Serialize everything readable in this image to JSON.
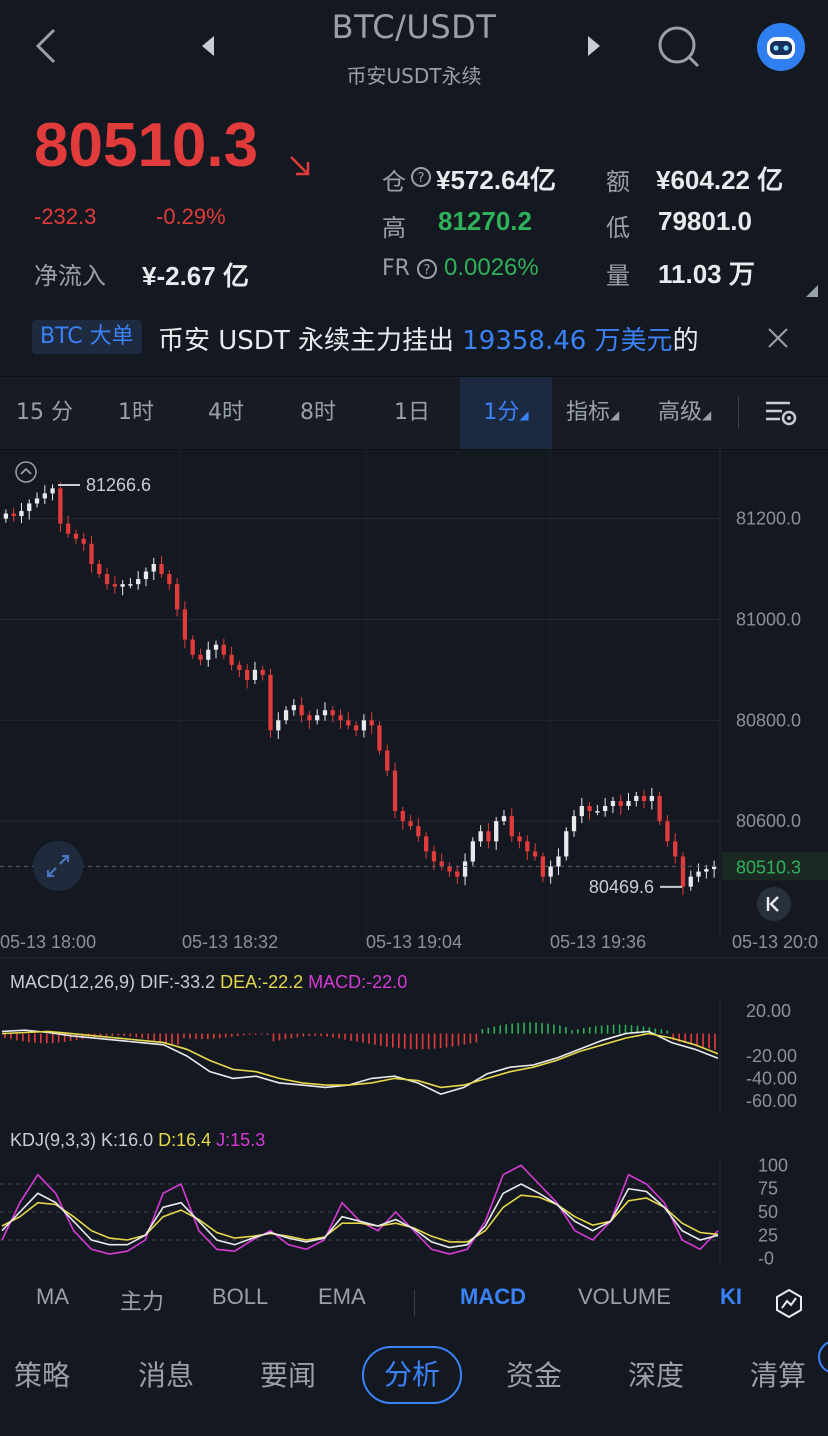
{
  "header": {
    "title": "BTC/USDT",
    "subtitle": "币安USDT永续",
    "icons": [
      "back-arrow-icon",
      "prev-triangle-icon",
      "next-triangle-icon",
      "search-icon",
      "assistant-robot-icon"
    ]
  },
  "quote": {
    "price": "80510.3",
    "change": "-232.3",
    "change_pct": "-0.29%",
    "net_inflow_label": "净流入",
    "net_inflow": "¥-2.67 亿",
    "open_interest_label": "仓",
    "open_interest": "¥572.64亿",
    "amount_label": "额",
    "amount": "¥604.22 亿",
    "high_label": "高",
    "high": "81270.2",
    "low_label": "低",
    "low": "79801.0",
    "fr_label": "FR",
    "fr": "0.0026%",
    "volume_label": "量",
    "volume": "11.03 万"
  },
  "ticker": {
    "tag": "BTC 大单",
    "text_prefix": "币安 USDT 永续主力挂出 ",
    "amount": "19358.46 万美元",
    "text_suffix": "的"
  },
  "interval_tabs": [
    "15 分",
    "1时",
    "4时",
    "8时",
    "1日",
    "1分",
    "指标",
    "高级"
  ],
  "active_interval": "1分",
  "chart_data": {
    "type": "candlestick",
    "y_ticks": [
      "81200.0",
      "81000.0",
      "80800.0",
      "80600.0"
    ],
    "x_ticks": [
      "05-13 18:00",
      "05-13 18:32",
      "05-13 19:04",
      "05-13 19:36",
      "05-13 20:0"
    ],
    "high_marker": "81266.6",
    "low_marker": "80469.6",
    "last_price": "80510.3",
    "ylim": [
      80400,
      81340
    ]
  },
  "macd": {
    "label": "MACD(12,26,9)",
    "dif": "DIF:-33.2",
    "dea": "DEA:-22.2",
    "macd": "MACD:-22.0",
    "y_ticks": [
      "20.00",
      "-20.00",
      "-40.00",
      "-60.00"
    ]
  },
  "kdj": {
    "label": "KDJ(9,3,3)",
    "k": "K:16.0",
    "d": "D:16.4",
    "j": "J:15.3",
    "y_ticks": [
      "100",
      "75",
      "50",
      "25",
      "-0"
    ]
  },
  "indicator_tabs": [
    "MA",
    "主力",
    "BOLL",
    "EMA",
    "MACD",
    "VOLUME",
    "KI"
  ],
  "active_indicator": "MACD",
  "bottom_nav": [
    "策略",
    "消息",
    "要闻",
    "分析",
    "资金",
    "深度",
    "清算"
  ],
  "active_nav": "分析",
  "colors": {
    "up": "#2fb15a",
    "down": "#e23b3b",
    "accent": "#3b82f6",
    "bg": "#141820"
  }
}
